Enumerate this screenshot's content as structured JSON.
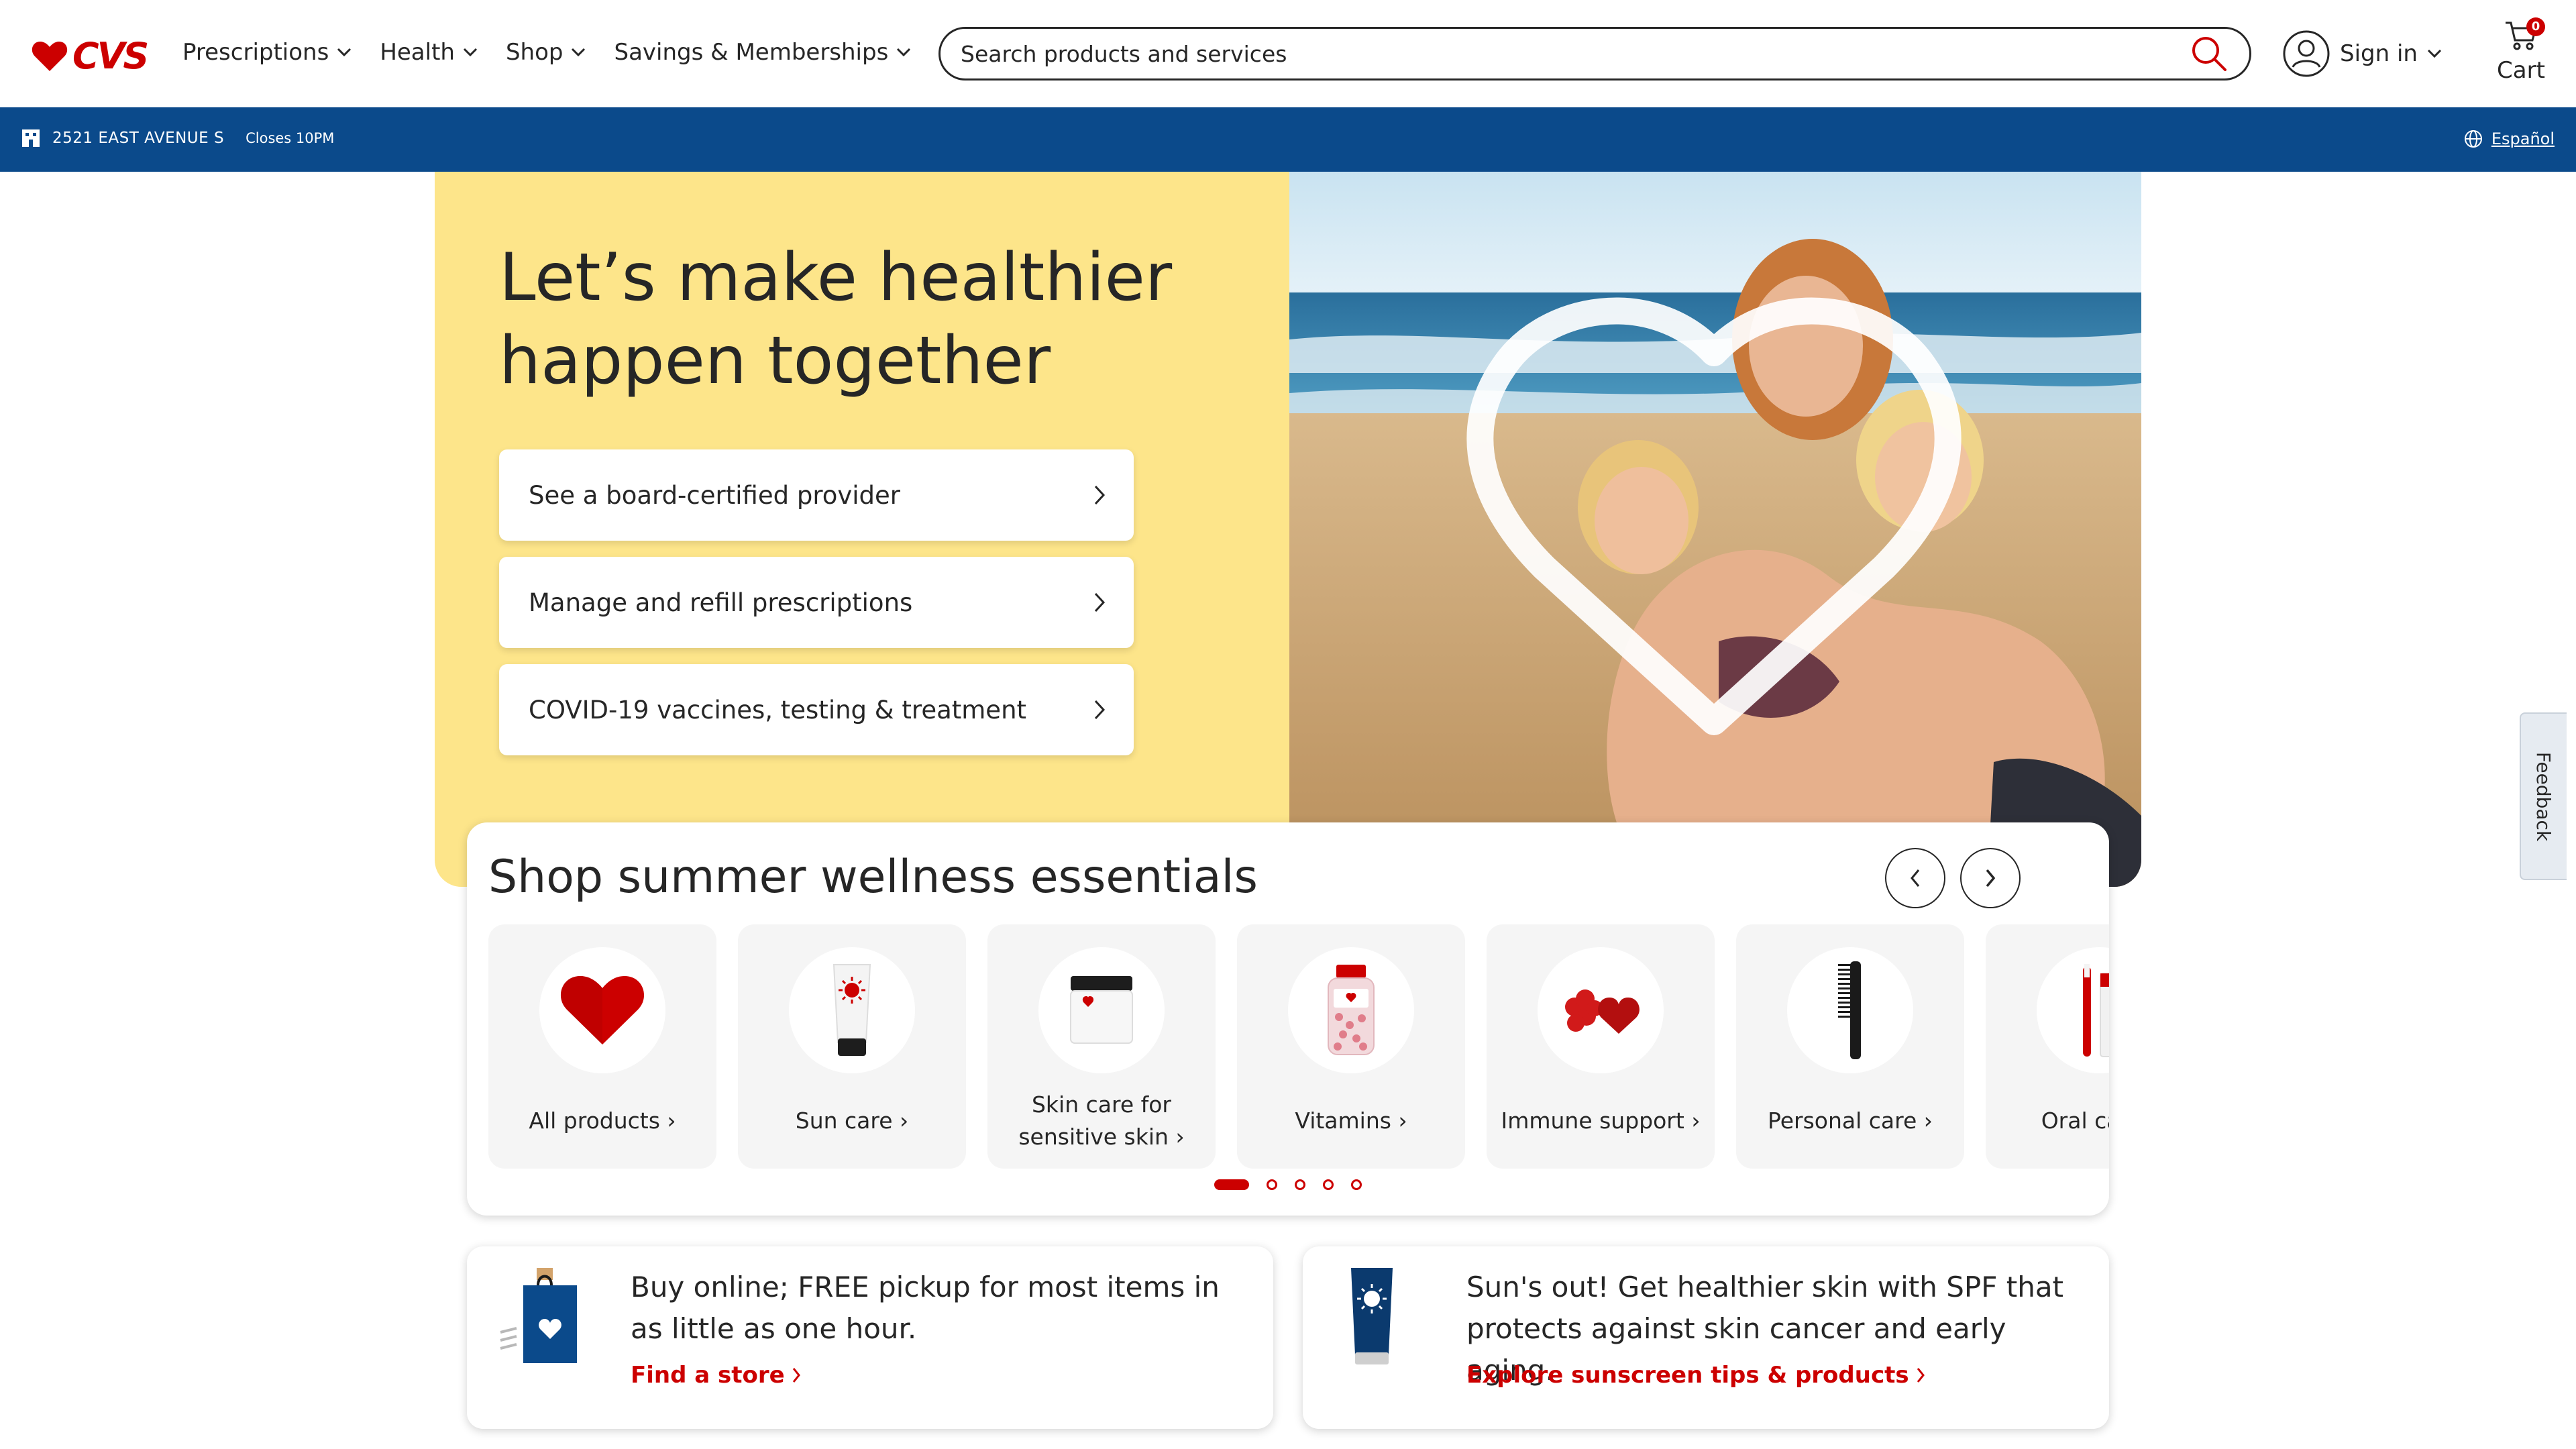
{
  "brand": {
    "logo_text": "CVS",
    "color": "#cc0000"
  },
  "nav": {
    "items": [
      {
        "label": "Prescriptions"
      },
      {
        "label": "Health"
      },
      {
        "label": "Shop"
      },
      {
        "label": "Savings & Memberships"
      }
    ]
  },
  "search": {
    "placeholder": "Search products and services"
  },
  "account": {
    "signin_label": "Sign in"
  },
  "cart": {
    "label": "Cart",
    "count": "0"
  },
  "store": {
    "address": "2521 EAST AVENUE S",
    "hours": "Closes 10PM",
    "language_link": "Español",
    "bar_color": "#0b4a8b"
  },
  "hero": {
    "title_line1": "Let’s make healthier",
    "title_line2": "happen together",
    "background": "#fde58a",
    "buttons": [
      {
        "label": "See a board-certified provider"
      },
      {
        "label": "Manage and refill prescriptions"
      },
      {
        "label": "COVID-19 vaccines, testing & treatment"
      }
    ]
  },
  "shop": {
    "title": "Shop summer wellness essentials",
    "categories": [
      {
        "label": "All products",
        "icon": "heart-icon"
      },
      {
        "label": "Sun care",
        "icon": "sunscreen-tube-icon"
      },
      {
        "label": "Skin care for sensitive skin",
        "icon": "cream-jar-icon"
      },
      {
        "label": "Vitamins",
        "icon": "vitamin-bottle-icon"
      },
      {
        "label": "Immune support",
        "icon": "gummies-icon"
      },
      {
        "label": "Personal care",
        "icon": "comb-icon"
      },
      {
        "label": "Oral care",
        "icon": "toothbrush-icon"
      }
    ],
    "pagination": {
      "pages": 5,
      "active": 1
    }
  },
  "promos": [
    {
      "text": "Buy online; FREE pickup for most items in as little as one hour.",
      "link": "Find a store",
      "icon": "shopping-bag-icon"
    },
    {
      "text": "Sun's out! Get healthier skin with SPF that protects against skin cancer and early aging.",
      "link": "Explore sunscreen tips & products",
      "icon": "sunscreen-icon"
    }
  ],
  "feedback": {
    "label": "Feedback"
  }
}
